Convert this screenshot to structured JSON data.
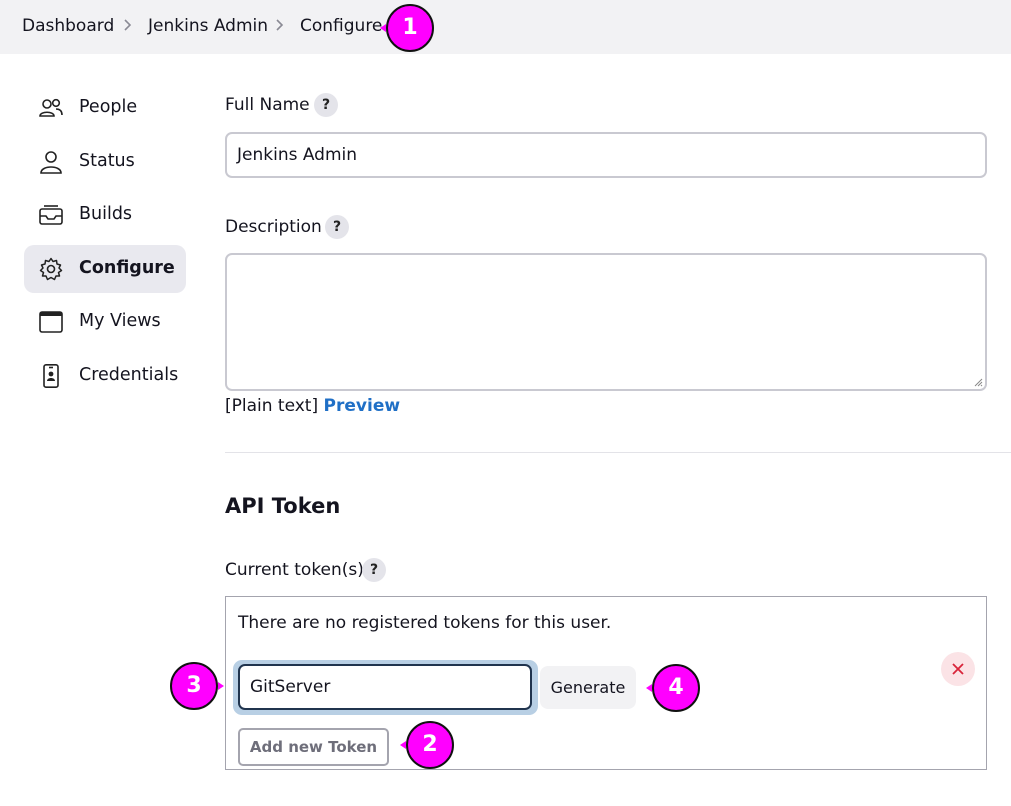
{
  "breadcrumb": {
    "items": [
      "Dashboard",
      "Jenkins Admin",
      "Configure"
    ]
  },
  "sidebar": {
    "items": [
      {
        "label": "People",
        "icon": "people-icon",
        "active": false
      },
      {
        "label": "Status",
        "icon": "user-icon",
        "active": false
      },
      {
        "label": "Builds",
        "icon": "inbox-icon",
        "active": false
      },
      {
        "label": "Configure",
        "icon": "gear-icon",
        "active": true
      },
      {
        "label": "My Views",
        "icon": "window-icon",
        "active": false
      },
      {
        "label": "Credentials",
        "icon": "id-card-icon",
        "active": false
      }
    ]
  },
  "form": {
    "full_name": {
      "label": "Full Name",
      "help": "?",
      "value": "Jenkins Admin"
    },
    "description": {
      "label": "Description",
      "help": "?",
      "value": "",
      "format_text": "[Plain text]",
      "preview_link": "Preview"
    }
  },
  "api_token": {
    "heading": "API Token",
    "current_tokens": {
      "label": "Current token(s)",
      "help": "?"
    },
    "empty_message": "There are no registered tokens for this user.",
    "token_name": "GitServer",
    "generate_label": "Generate",
    "add_label": "Add new Token",
    "remove_icon": "close-icon"
  },
  "annotations": [
    "1",
    "2",
    "3",
    "4"
  ],
  "colors": {
    "annotation": "#ff00ff",
    "link": "#1f6fc6",
    "focus_border": "#20344e",
    "remove": "#d8243a"
  }
}
